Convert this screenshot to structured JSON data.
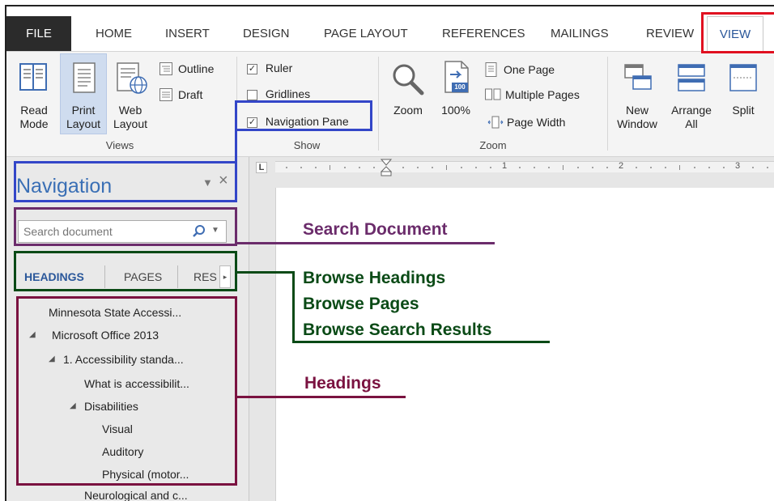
{
  "ribbon_tabs": {
    "file": "FILE",
    "home": "HOME",
    "insert": "INSERT",
    "design": "DESIGN",
    "page_layout": "PAGE LAYOUT",
    "references": "REFERENCES",
    "mailings": "MAILINGS",
    "review": "REVIEW",
    "view": "VIEW"
  },
  "views_group": {
    "label": "Views",
    "read_mode": [
      "Read",
      "Mode"
    ],
    "print_layout": [
      "Print",
      "Layout"
    ],
    "web_layout": [
      "Web",
      "Layout"
    ],
    "outline": "Outline",
    "draft": "Draft"
  },
  "show_group": {
    "label": "Show",
    "ruler": "Ruler",
    "ruler_checked": true,
    "gridlines": "Gridlines",
    "gridlines_checked": false,
    "navigation_pane": "Navigation Pane",
    "navigation_pane_checked": true
  },
  "zoom_group": {
    "label": "Zoom",
    "zoom": "Zoom",
    "hundred": "100%",
    "hundred_badge": "100",
    "one_page": "One Page",
    "multiple_pages": "Multiple Pages",
    "page_width": "Page Width"
  },
  "window_group": {
    "new_window": [
      "New",
      "Window"
    ],
    "arrange_all": [
      "Arrange",
      "All"
    ],
    "split": "Split"
  },
  "ruler": {
    "marks": [
      "1",
      "2",
      "3"
    ],
    "tab_selector": "L"
  },
  "navigation": {
    "title": "Navigation",
    "search_placeholder": "Search document",
    "tabs": {
      "headings": "HEADINGS",
      "pages": "PAGES",
      "results": "RES"
    },
    "headings": [
      "Minnesota State Accessi...",
      "Microsoft Office 2013",
      "1. Accessibility standa...",
      "What is accessibilit...",
      "Disabilities",
      "Visual",
      "Auditory",
      "Physical (motor...",
      "Neurological and c..."
    ]
  },
  "callouts": {
    "search_document": "Search Document",
    "browse_headings": "Browse Headings",
    "browse_pages": "Browse Pages",
    "browse_search_results": "Browse Search Results",
    "headings": "Headings"
  },
  "colors": {
    "blue": "#3346c8",
    "purple": "#6b2c6b",
    "green": "#0a4a16",
    "maroon": "#7a1240",
    "red": "#e01020"
  }
}
